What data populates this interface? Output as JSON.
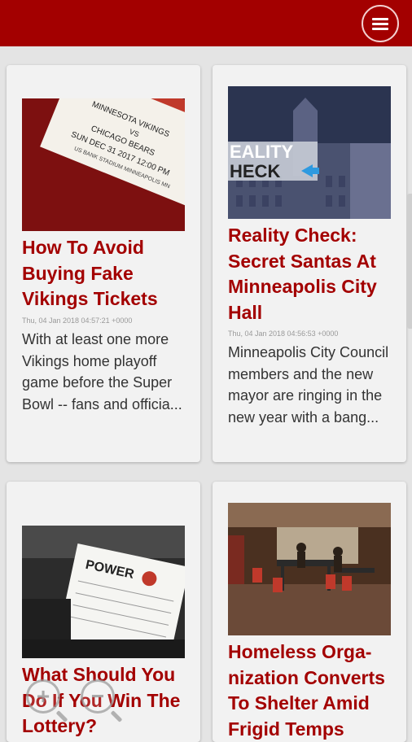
{
  "header": {
    "menu_icon": "hamburger-menu-icon",
    "brand_color": "#a30000"
  },
  "articles": [
    {
      "title": "How To Avoid Buying Fake Vikings Tickets",
      "date": "Thu, 04 Jan 2018 04:57:21 +0000",
      "summary": "With at least one more Vikings home playoff game before the Super Bowl -- fans and officia...",
      "image_text": {
        "line1": "MINNESOTA VIKINGS",
        "line2": "VS",
        "line3": "CHICAGO BEARS",
        "line4": "SUN DEC 31 2017 12:00 PM",
        "line5": "US BANK STADIUM MINNEAPOLIS MN"
      }
    },
    {
      "title": "Reality Check: Secret Santas At Minneapolis City Hall",
      "date": "Thu, 04 Jan 2018 04:56:53 +0000",
      "summary": "Minneapolis City Council members and the new mayor are ringing in the new year with a bang...",
      "image_text": {
        "reality": "EALITY",
        "check": "HECK"
      }
    },
    {
      "title": "What Should You Do If You Win The Lottery?",
      "image_text": {
        "powerball": "POWER"
      }
    },
    {
      "title": "Homeless Orga-nization Converts To Shelter Amid Frigid Temps"
    }
  ],
  "zoom": {
    "in_symbol": "+",
    "out_symbol": "−"
  }
}
